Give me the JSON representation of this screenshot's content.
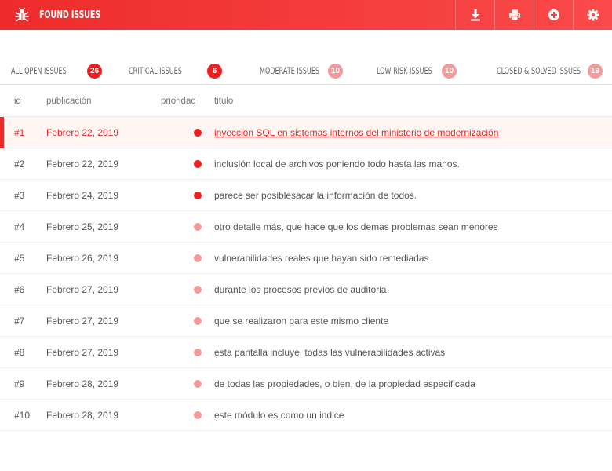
{
  "header": {
    "title": "Found Issues",
    "icons": [
      "bug-icon",
      "download-icon",
      "print-icon",
      "add-circle-icon",
      "gear-icon"
    ]
  },
  "colors": {
    "brand": "#ee2b2b",
    "critical": "#ee1f1f",
    "noncritical": "#f49a9a",
    "selected_bg": "#fff5f3"
  },
  "tabs": [
    {
      "label": "All open issues",
      "count": "26",
      "style": "strong"
    },
    {
      "label": "Critical issues",
      "count": "6",
      "style": "strong"
    },
    {
      "label": "Moderate issues",
      "count": "10",
      "style": "soft"
    },
    {
      "label": "Low risk issues",
      "count": "10",
      "style": "soft"
    },
    {
      "label": "Closed & solved issues",
      "count": "19",
      "style": "soft"
    }
  ],
  "table": {
    "columns": [
      "id",
      "publicación",
      "prioridad",
      "titulo"
    ],
    "rows": [
      {
        "id": "#1",
        "date": "Febrero 22, 2019",
        "priority": "critical",
        "title": "inyección SQL en sistemas internos del ministerio de modernización",
        "selected": true
      },
      {
        "id": "#2",
        "date": "Febrero 22, 2019",
        "priority": "critical",
        "title": "inclusión local de archivos poniendo todo hasta las manos."
      },
      {
        "id": "#3",
        "date": "Febrero 24, 2019",
        "priority": "critical",
        "title": "parece ser posiblesacar la información de todos."
      },
      {
        "id": "#4",
        "date": "Febrero 25, 2019",
        "priority": "moderate",
        "title": "otro detalle más, que hace que los demas problemas sean menores"
      },
      {
        "id": "#5",
        "date": "Febrero 26, 2019",
        "priority": "moderate",
        "title": "vulnerabilidades reales que hayan sido remediadas"
      },
      {
        "id": "#6",
        "date": "Febrero 27, 2019",
        "priority": "moderate",
        "title": "durante los procesos previos de auditoria"
      },
      {
        "id": "#7",
        "date": "Febrero 27, 2019",
        "priority": "moderate",
        "title": "que se realizaron para este mismo cliente"
      },
      {
        "id": "#8",
        "date": "Febrero 27, 2019",
        "priority": "moderate",
        "title": "esta pantalla incluye, todas las vulnerabilidades activas"
      },
      {
        "id": "#9",
        "date": "Febrero 28, 2019",
        "priority": "moderate",
        "title": "de todas las propiedades, o bien, de la propiedad especificada"
      },
      {
        "id": "#10",
        "date": "Febrero 28, 2019",
        "priority": "moderate",
        "title": "este módulo es como un indice"
      }
    ]
  }
}
